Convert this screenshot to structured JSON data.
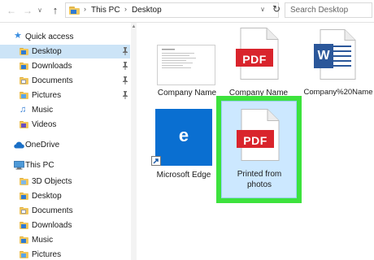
{
  "address_bar": {
    "crumbs": [
      "This PC",
      "Desktop"
    ],
    "search_placeholder": "Search Desktop"
  },
  "nav_pane": {
    "items": [
      {
        "label": "Quick access",
        "icon": "star-icon",
        "pinned": false,
        "selected": false
      },
      {
        "label": "Desktop",
        "icon": "folder-icon",
        "pinned": true,
        "selected": true
      },
      {
        "label": "Downloads",
        "icon": "folder-icon",
        "pinned": true,
        "selected": false
      },
      {
        "label": "Documents",
        "icon": "folder-icon",
        "pinned": true,
        "selected": false
      },
      {
        "label": "Pictures",
        "icon": "folder-icon",
        "pinned": true,
        "selected": false
      },
      {
        "label": "Music",
        "icon": "folder-icon",
        "pinned": false,
        "selected": false
      },
      {
        "label": "Videos",
        "icon": "folder-icon",
        "pinned": false,
        "selected": false
      },
      {
        "label": "OneDrive",
        "icon": "cloud-icon",
        "pinned": false,
        "selected": false
      },
      {
        "label": "This PC",
        "icon": "computer-icon",
        "pinned": false,
        "selected": false
      },
      {
        "label": "3D Objects",
        "icon": "folder-icon",
        "pinned": false,
        "selected": false
      },
      {
        "label": "Desktop",
        "icon": "folder-icon",
        "pinned": false,
        "selected": false
      },
      {
        "label": "Documents",
        "icon": "folder-icon",
        "pinned": false,
        "selected": false
      },
      {
        "label": "Downloads",
        "icon": "folder-icon",
        "pinned": false,
        "selected": false
      },
      {
        "label": "Music",
        "icon": "folder-icon",
        "pinned": false,
        "selected": false
      },
      {
        "label": "Pictures",
        "icon": "folder-icon",
        "pinned": false,
        "selected": false
      }
    ]
  },
  "files": [
    {
      "label": "Company Name",
      "icon": "document-thumbnail-icon"
    },
    {
      "label": "Company Name",
      "icon": "pdf-file-icon",
      "badge": "PDF"
    },
    {
      "label": "Company%20N­ame",
      "icon": "word-file-icon",
      "badge": "W"
    },
    {
      "label": "Microsoft Edge",
      "icon": "edge-shortcut-icon",
      "badge": "e"
    },
    {
      "label": "Printed from photos",
      "icon": "pdf-file-icon",
      "badge": "PDF"
    }
  ],
  "colors": {
    "selection": "#cce4f7",
    "highlight": "#3de23d",
    "pdf_red": "#d9242c",
    "word_blue": "#2b579a",
    "edge_blue": "#0a6fd1"
  }
}
